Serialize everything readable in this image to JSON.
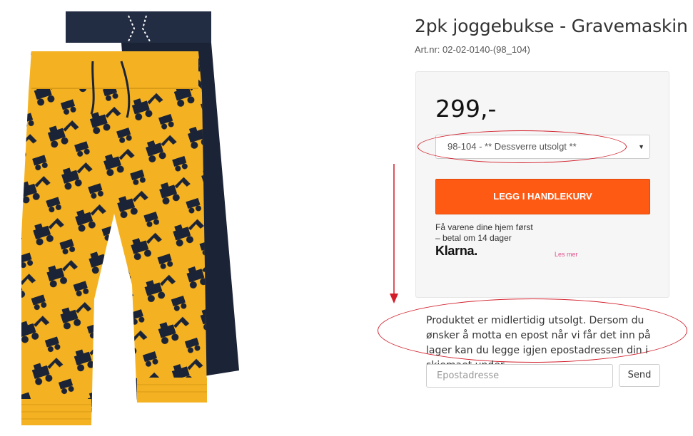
{
  "product": {
    "title": "2pk joggebukse - Gravemaskin",
    "art_nr": "Art.nr: 02-02-0140-(98_104)",
    "price": "299,-",
    "size_select": {
      "selected": "98-104 - ** Dessverre utsolgt **"
    },
    "add_to_cart_label": "LEGG I HANDLEKURV"
  },
  "klarna": {
    "line1": "Få varene dine hjem først",
    "line2": "– betal om 14 dager",
    "logo": "Klarna.",
    "read_more": "Les mer"
  },
  "notify": {
    "message": "Produktet er midlertidig utsolgt. Dersom du ønsker å motta en epost når vi får det inn på lager kan du legge igjen epostadressen din i skjemaet under.",
    "email_placeholder": "Epostadresse",
    "send_label": "Send"
  },
  "colors": {
    "cta": "#ff5a14",
    "annotation": "#d21e2a",
    "pants_yellow": "#f4b223",
    "pants_navy": "#1b2336"
  }
}
